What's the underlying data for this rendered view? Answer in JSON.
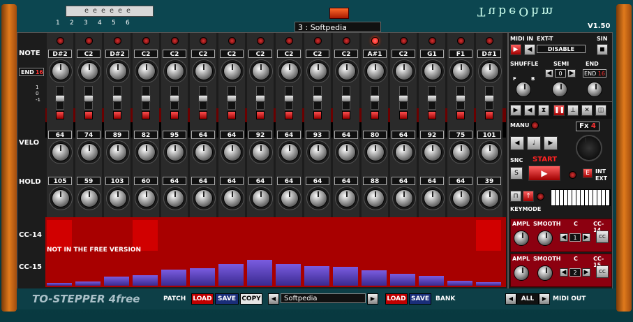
{
  "app": {
    "title": "TubeOhm",
    "version": "V1.50",
    "product": "TO-STEPPER 4free"
  },
  "header": {
    "bank_digits": "eeeeee",
    "bank_numbers": [
      "1",
      "2",
      "3",
      "4",
      "5",
      "6"
    ],
    "patch_display": "3 :  Softpedia"
  },
  "rows": {
    "note": "NOTE",
    "end": "END",
    "end_value": "16",
    "slider_scale": [
      "1",
      "0",
      "-1"
    ],
    "velo": "VELO",
    "hold": "HOLD",
    "cc14": "CC-14",
    "cc15": "CC-15"
  },
  "steps": [
    {
      "note": "D#2",
      "velo": "64",
      "hold": "105",
      "led_on": false,
      "cc14": 0.95,
      "cc15": 0.08
    },
    {
      "note": "C2",
      "velo": "74",
      "hold": "59",
      "led_on": false,
      "cc14": 0.0,
      "cc15": 0.12
    },
    {
      "note": "D#2",
      "velo": "89",
      "hold": "103",
      "led_on": false,
      "cc14": 0.0,
      "cc15": 0.28
    },
    {
      "note": "C2",
      "velo": "82",
      "hold": "60",
      "led_on": false,
      "cc14": 0.95,
      "cc15": 0.32
    },
    {
      "note": "C2",
      "velo": "95",
      "hold": "64",
      "led_on": false,
      "cc14": 0.0,
      "cc15": 0.5
    },
    {
      "note": "C2",
      "velo": "64",
      "hold": "64",
      "led_on": false,
      "cc14": 0.0,
      "cc15": 0.55
    },
    {
      "note": "C2",
      "velo": "64",
      "hold": "64",
      "led_on": false,
      "cc14": 0.0,
      "cc15": 0.68
    },
    {
      "note": "C2",
      "velo": "92",
      "hold": "64",
      "led_on": false,
      "cc14": 0.0,
      "cc15": 0.8
    },
    {
      "note": "C2",
      "velo": "64",
      "hold": "64",
      "led_on": false,
      "cc14": 0.0,
      "cc15": 0.68
    },
    {
      "note": "C2",
      "velo": "93",
      "hold": "64",
      "led_on": false,
      "cc14": 0.0,
      "cc15": 0.6
    },
    {
      "note": "C2",
      "velo": "64",
      "hold": "64",
      "led_on": false,
      "cc14": 0.0,
      "cc15": 0.58
    },
    {
      "note": "A#1",
      "velo": "80",
      "hold": "88",
      "led_on": true,
      "cc14": 0.0,
      "cc15": 0.48
    },
    {
      "note": "C2",
      "velo": "64",
      "hold": "64",
      "led_on": false,
      "cc14": 0.0,
      "cc15": 0.38
    },
    {
      "note": "G1",
      "velo": "92",
      "hold": "64",
      "led_on": false,
      "cc14": 0.0,
      "cc15": 0.3
    },
    {
      "note": "F1",
      "velo": "75",
      "hold": "64",
      "led_on": false,
      "cc14": 0.0,
      "cc15": 0.15
    },
    {
      "note": "D#1",
      "velo": "101",
      "hold": "39",
      "led_on": false,
      "cc14": 0.95,
      "cc15": 0.1
    }
  ],
  "cc_note": "NOT IN THE FREE VERSION",
  "right": {
    "midi_in": "MIDI IN",
    "ext_t": "EXT-T",
    "sin": "SIN",
    "disable": "DISABLE",
    "shuffle": "SHUFFLE",
    "semi": "SEMI",
    "semi_value": "0",
    "end": "END",
    "end_value": "16",
    "shuffle_f": "F",
    "shuffle_b": "B",
    "manu": "MANU",
    "fx_label": "Fx",
    "fx_value": "4",
    "snc": "SNC",
    "start": "START",
    "int": "INT",
    "ext": "EXT",
    "keymode": "KEYMODE",
    "cc_panels": [
      {
        "ampl": "AMPL",
        "smooth": "SMOOTH",
        "c": "C",
        "cc": "CC-14",
        "value": "1"
      },
      {
        "ampl": "AMPL",
        "smooth": "SMOOTH",
        "c": "C",
        "cc": "CC-15",
        "value": "2"
      }
    ],
    "cc_button": "CC"
  },
  "bottom": {
    "patch": "PATCH",
    "load": "LOAD",
    "save": "SAVE",
    "copy": "COPY",
    "patch_name": "Softpedia",
    "bank": "BANK",
    "all": "ALL",
    "midi_out": "MIDI OUT"
  },
  "colors": {
    "accent": "#c00000",
    "background": "#0c4650",
    "rail": "#e07a1c",
    "cc15_bar": "#6a52d8"
  }
}
